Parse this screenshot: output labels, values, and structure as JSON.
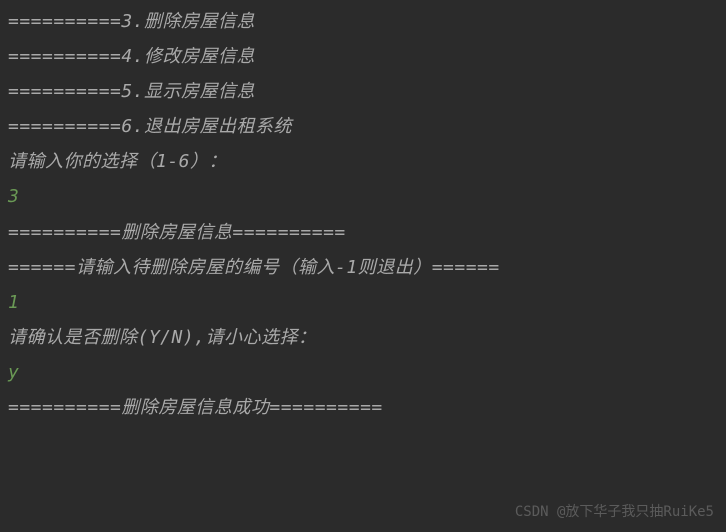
{
  "lines": {
    "menu3": "==========3.删除房屋信息",
    "menu4": "==========4.修改房屋信息",
    "menu5": "==========5.显示房屋信息",
    "menu6": "==========6.退出房屋出租系统",
    "prompt_choice": "请输入你的选择（1-6）：",
    "input_choice": "3",
    "header_delete": "==========删除房屋信息==========",
    "prompt_id": "======请输入待删除房屋的编号（输入-1则退出）======",
    "input_id": "1",
    "prompt_confirm": "请确认是否删除(Y/N),请小心选择：",
    "input_confirm": "y",
    "result_success": "==========删除房屋信息成功=========="
  },
  "watermark": "CSDN @放下华子我只抽RuiKe5"
}
